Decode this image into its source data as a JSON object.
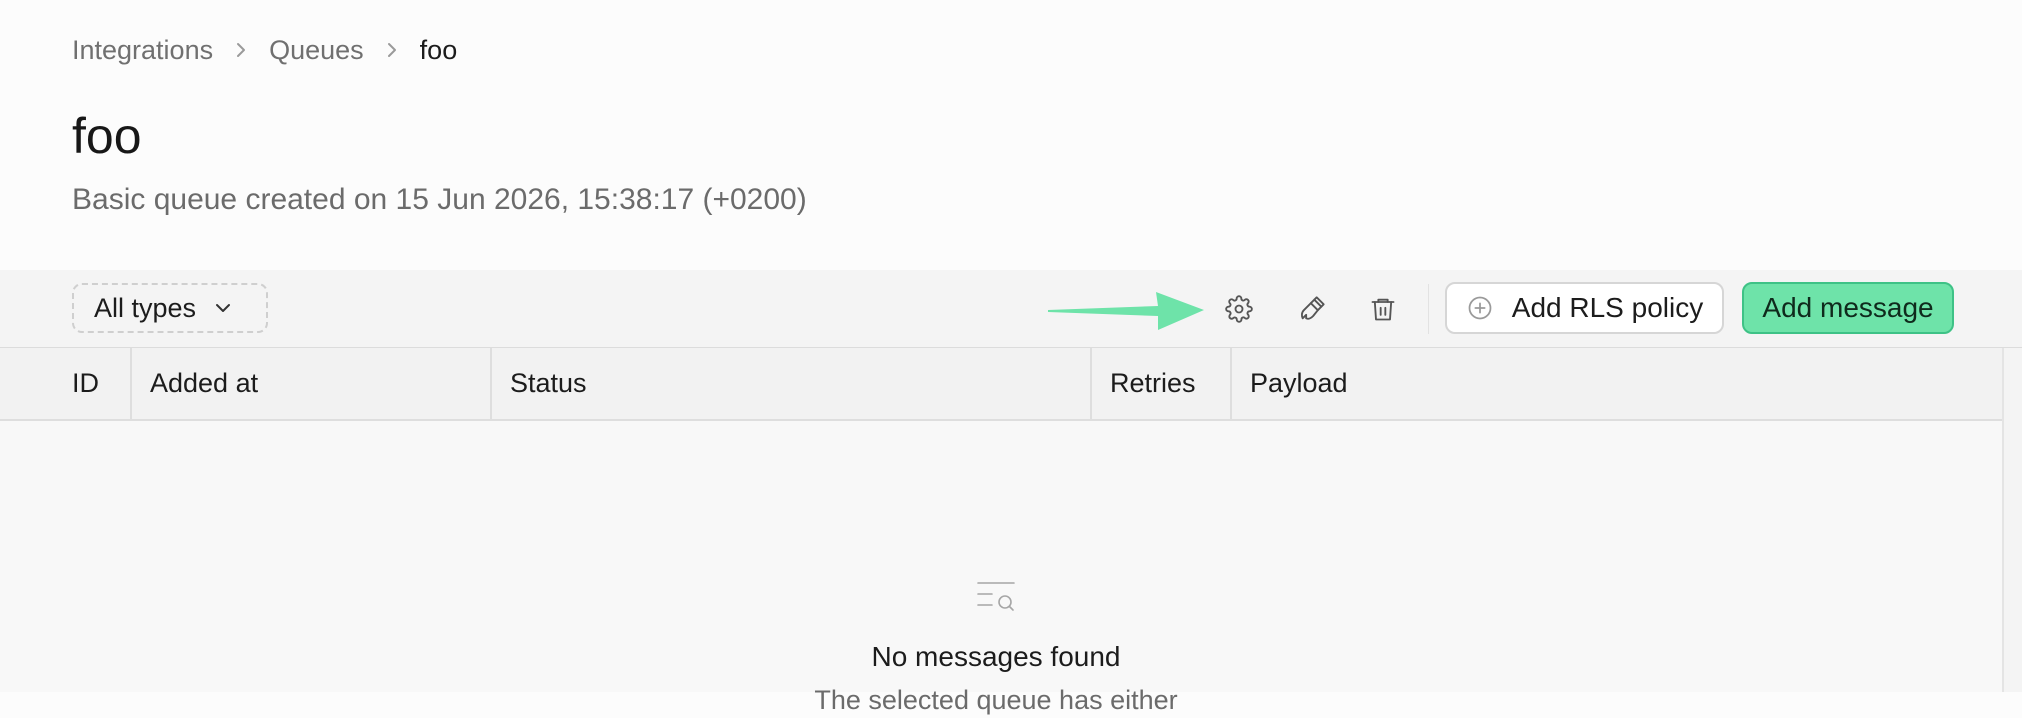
{
  "breadcrumb": {
    "items": [
      "Integrations",
      "Queues"
    ],
    "current": "foo"
  },
  "page": {
    "title": "foo",
    "subtitle": "Basic queue created on 15 Jun 2026, 15:38:17 (+0200)"
  },
  "toolbar": {
    "filter_label": "All types",
    "icons": [
      "gear-icon",
      "paintbrush-icon",
      "trash-icon"
    ],
    "add_rls_label": "Add RLS policy",
    "add_message_label": "Add message"
  },
  "table": {
    "columns": [
      "ID",
      "Added at",
      "Status",
      "Retries",
      "Payload"
    ]
  },
  "empty_state": {
    "title": "No messages found",
    "subtitle": "The selected queue has either"
  },
  "colors": {
    "accent": "#6ee3a9",
    "accent_border": "#3ec286",
    "arrow": "#6ee3a9"
  }
}
